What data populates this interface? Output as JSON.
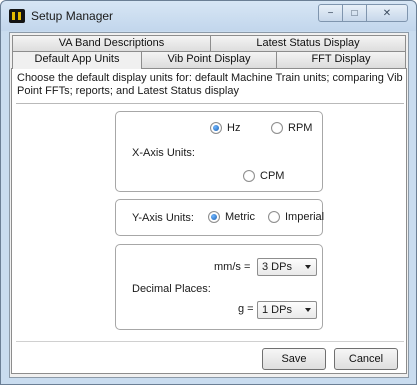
{
  "window": {
    "title": "Setup Manager",
    "controls": {
      "minimize": "−",
      "maximize": "□",
      "close": "✕"
    }
  },
  "tabs": {
    "row1": [
      {
        "label": "VA Band Descriptions"
      },
      {
        "label": "Latest Status Display"
      }
    ],
    "row2": [
      {
        "label": "Default App Units",
        "active": true
      },
      {
        "label": "Vib Point Display"
      },
      {
        "label": "FFT Display"
      }
    ]
  },
  "panel": {
    "description": "Choose the default display units for: default Machine Train units; comparing Vib Point FFTs; reports; and Latest Status display",
    "x_axis": {
      "label": "X-Axis Units:",
      "options": [
        {
          "label": "Hz",
          "checked": true
        },
        {
          "label": "RPM",
          "checked": false
        },
        {
          "label": "CPM",
          "checked": false
        }
      ]
    },
    "y_axis": {
      "label": "Y-Axis Units:",
      "options": [
        {
          "label": "Metric",
          "checked": true
        },
        {
          "label": "Imperial",
          "checked": false
        }
      ]
    },
    "decimal": {
      "label": "Decimal Places:",
      "mms_label": "mm/s =",
      "mms_value": "3 DPs",
      "g_label": "g =",
      "g_value": "1 DPs"
    }
  },
  "buttons": {
    "save": "Save",
    "cancel": "Cancel"
  }
}
